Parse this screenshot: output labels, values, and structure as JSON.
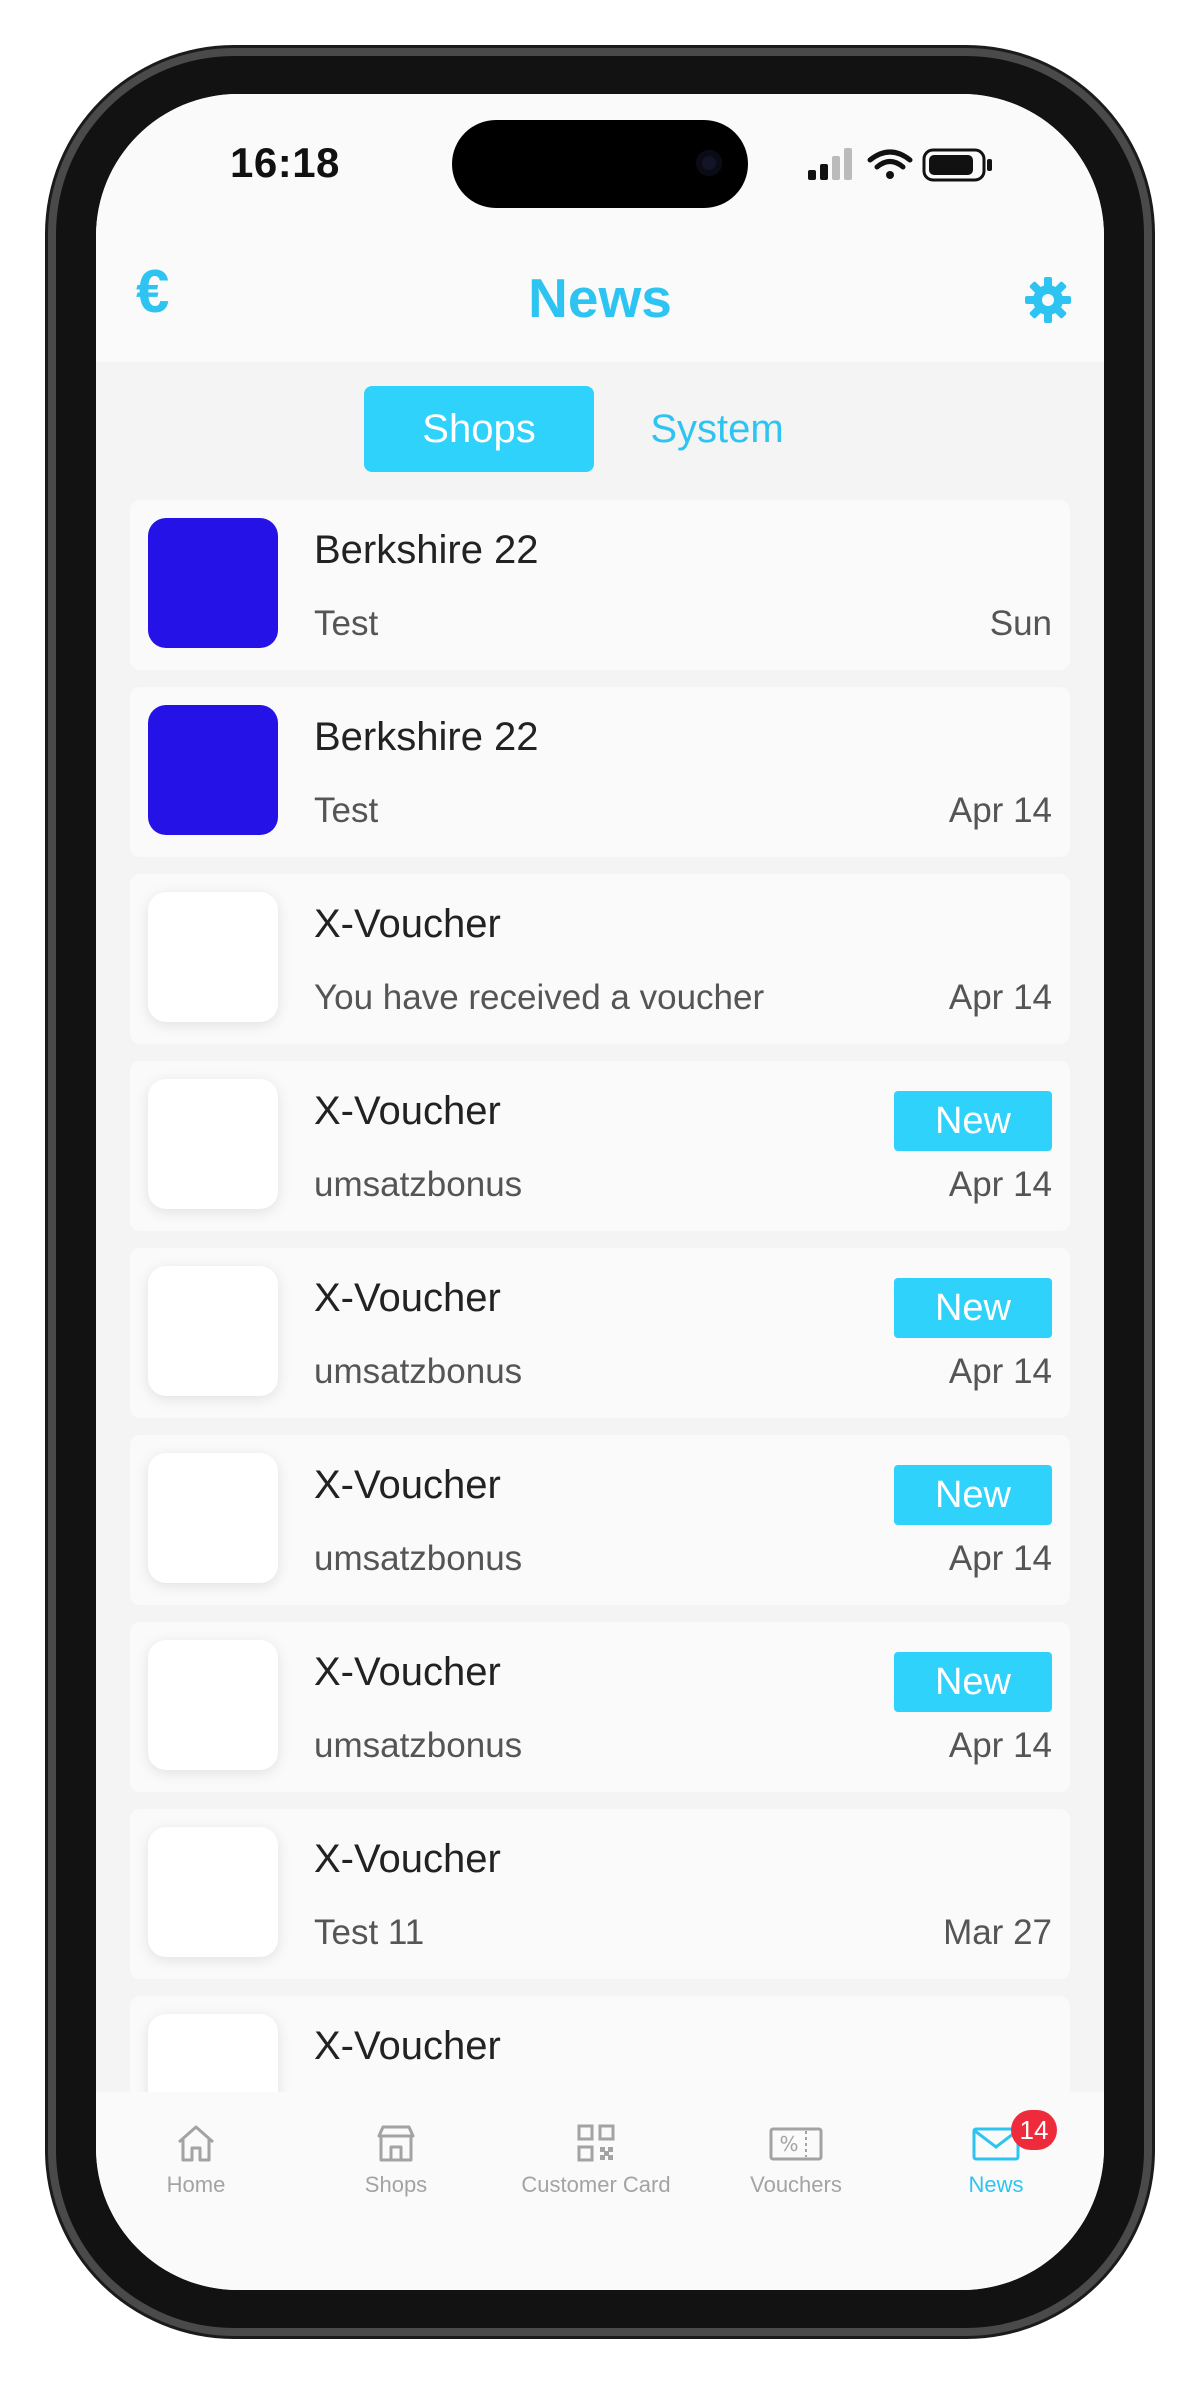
{
  "status_bar": {
    "time": "16:18"
  },
  "header": {
    "currency_symbol": "€",
    "title": "News"
  },
  "tabs": [
    {
      "label": "Shops",
      "active": true
    },
    {
      "label": "System",
      "active": false
    }
  ],
  "messages": [
    {
      "sender": "Berkshire 22",
      "text": "Test",
      "date": "Sun",
      "thumb": "blue",
      "badge": ""
    },
    {
      "sender": "Berkshire 22",
      "text": "Test",
      "date": "Apr 14",
      "thumb": "blue",
      "badge": ""
    },
    {
      "sender": "X-Voucher",
      "text": "You have received a voucher",
      "date": "Apr 14",
      "thumb": "white",
      "badge": ""
    },
    {
      "sender": "X-Voucher",
      "text": "umsatzbonus",
      "date": "Apr 14",
      "thumb": "white",
      "badge": "New"
    },
    {
      "sender": "X-Voucher",
      "text": "umsatzbonus",
      "date": "Apr 14",
      "thumb": "white",
      "badge": "New"
    },
    {
      "sender": "X-Voucher",
      "text": "umsatzbonus",
      "date": "Apr 14",
      "thumb": "white",
      "badge": "New"
    },
    {
      "sender": "X-Voucher",
      "text": "umsatzbonus",
      "date": "Apr 14",
      "thumb": "white",
      "badge": "New"
    },
    {
      "sender": "X-Voucher",
      "text": "Test 11",
      "date": "Mar 27",
      "thumb": "white",
      "badge": ""
    },
    {
      "sender": "X-Voucher",
      "text": "",
      "date": "",
      "thumb": "white",
      "badge": ""
    }
  ],
  "bottom_nav": {
    "items": [
      {
        "label": "Home",
        "icon": "home-icon"
      },
      {
        "label": "Shops",
        "icon": "shop-icon"
      },
      {
        "label": "Customer Card",
        "icon": "qr-code-icon"
      },
      {
        "label": "Vouchers",
        "icon": "voucher-icon"
      },
      {
        "label": "News",
        "icon": "mail-icon",
        "active": true,
        "badge": "14"
      }
    ]
  },
  "colors": {
    "accent": "#2ec4f1",
    "tab_active_bg": "#2ed2fa",
    "shop_thumb": "#2412e6",
    "badge_red": "#ee2b3b",
    "nav_inactive": "#a3a3a3"
  }
}
